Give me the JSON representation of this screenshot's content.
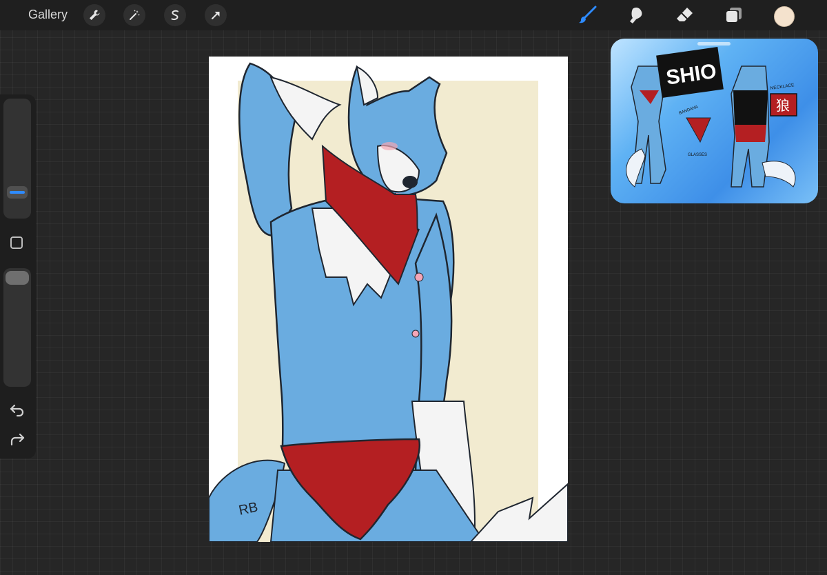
{
  "toolbar": {
    "gallery_label": "Gallery",
    "left_tools": [
      "wrench-icon",
      "magic-wand-icon",
      "selection-icon",
      "transform-arrow-icon"
    ],
    "right_tools": [
      "brush-icon",
      "smudge-icon",
      "eraser-icon",
      "layers-icon"
    ],
    "active_tool": "brush-icon",
    "accent_color": "#2e8bff",
    "current_color": "#f4e2cd"
  },
  "sidebar": {
    "controls": [
      "brush-size-slider",
      "modify-button",
      "opacity-slider",
      "undo-arrow-icon",
      "redo-arrow-icon"
    ]
  },
  "canvas": {
    "signature": "RB",
    "colors": {
      "background": "#f2ebd0",
      "fur_blue": "#6aace0",
      "fur_white": "#f4f4f4",
      "bandana_red": "#b41f22",
      "lineart": "#1f2630"
    }
  },
  "reference": {
    "title_text": "SHIO",
    "label_necklace": "NECKLACE",
    "label_bandana": "BANDANA",
    "label_glasses": "GLASSES",
    "kanji": "狼"
  }
}
